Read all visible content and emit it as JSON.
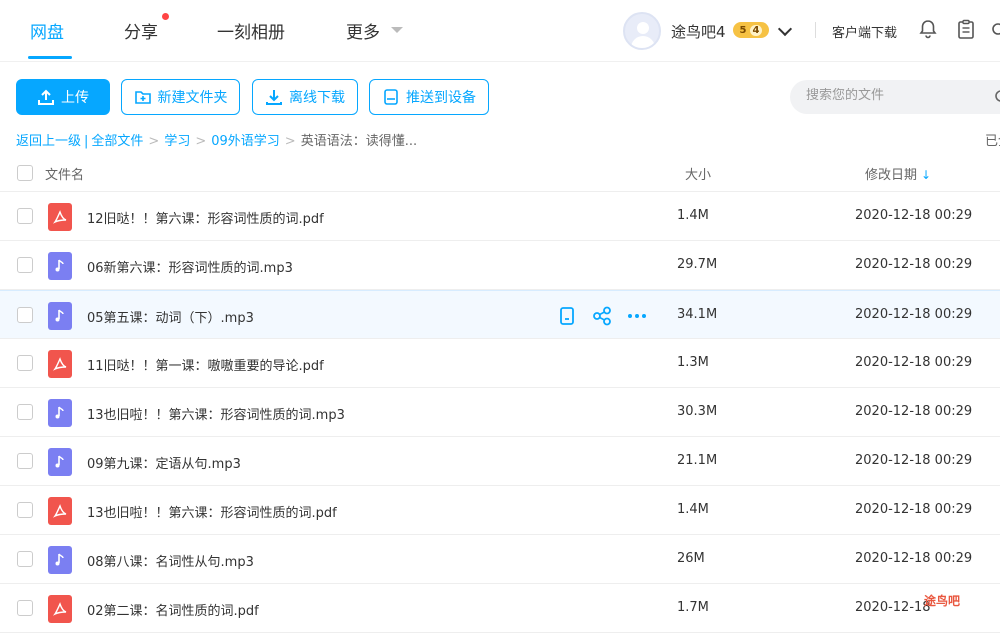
{
  "nav": {
    "items": [
      {
        "label": "网盘",
        "active": true
      },
      {
        "label": "分享",
        "has_dot": true
      },
      {
        "label": "一刻相册"
      },
      {
        "label": "更多"
      }
    ]
  },
  "user": {
    "name": "途鸟吧4",
    "vip_level": "5",
    "vip_sub": "4",
    "client_download": "客户端下载"
  },
  "toolbar": {
    "upload": "上传",
    "new_folder": "新建文件夹",
    "offline_download": "离线下载",
    "push_device": "推送到设备"
  },
  "search": {
    "placeholder": "搜索您的文件"
  },
  "breadcrumb": {
    "back": "返回上一级",
    "all": "全部文件",
    "p1": "学习",
    "p2": "09外语学习",
    "current": "英语语法：读得懂..."
  },
  "loaded_status": "已全",
  "table": {
    "col_name": "文件名",
    "col_size": "大小",
    "col_date": "修改日期",
    "rows": [
      {
        "name": "12旧哒！！第六课：形容词性质的词.pdf",
        "type": "pdf",
        "size": "1.4M",
        "date": "2020-12-18 00:29"
      },
      {
        "name": "06新第六课：形容词性质的词.mp3",
        "type": "mp3",
        "size": "29.7M",
        "date": "2020-12-18 00:29"
      },
      {
        "name": "05第五课：动词（下）.mp3",
        "type": "mp3",
        "size": "34.1M",
        "date": "2020-12-18 00:29",
        "hover": true
      },
      {
        "name": "11旧哒！！第一课：嗷嗷重要的导论.pdf",
        "type": "pdf",
        "size": "1.3M",
        "date": "2020-12-18 00:29"
      },
      {
        "name": "13也旧啦！！第六课：形容词性质的词.mp3",
        "type": "mp3",
        "size": "30.3M",
        "date": "2020-12-18 00:29"
      },
      {
        "name": "09第九课：定语从句.mp3",
        "type": "mp3",
        "size": "21.1M",
        "date": "2020-12-18 00:29"
      },
      {
        "name": "13也旧啦！！第六课：形容词性质的词.pdf",
        "type": "pdf",
        "size": "1.4M",
        "date": "2020-12-18 00:29"
      },
      {
        "name": "08第八课：名词性从句.mp3",
        "type": "mp3",
        "size": "26M",
        "date": "2020-12-18 00:29"
      },
      {
        "name": "02第二课：名词性质的词.pdf",
        "type": "pdf",
        "size": "1.7M",
        "date": "2020-12-18"
      }
    ]
  },
  "watermark": "途鸟吧",
  "colors": {
    "accent": "#06a7ff",
    "pdf": "#f1554d",
    "audio": "#7b7ff2"
  }
}
